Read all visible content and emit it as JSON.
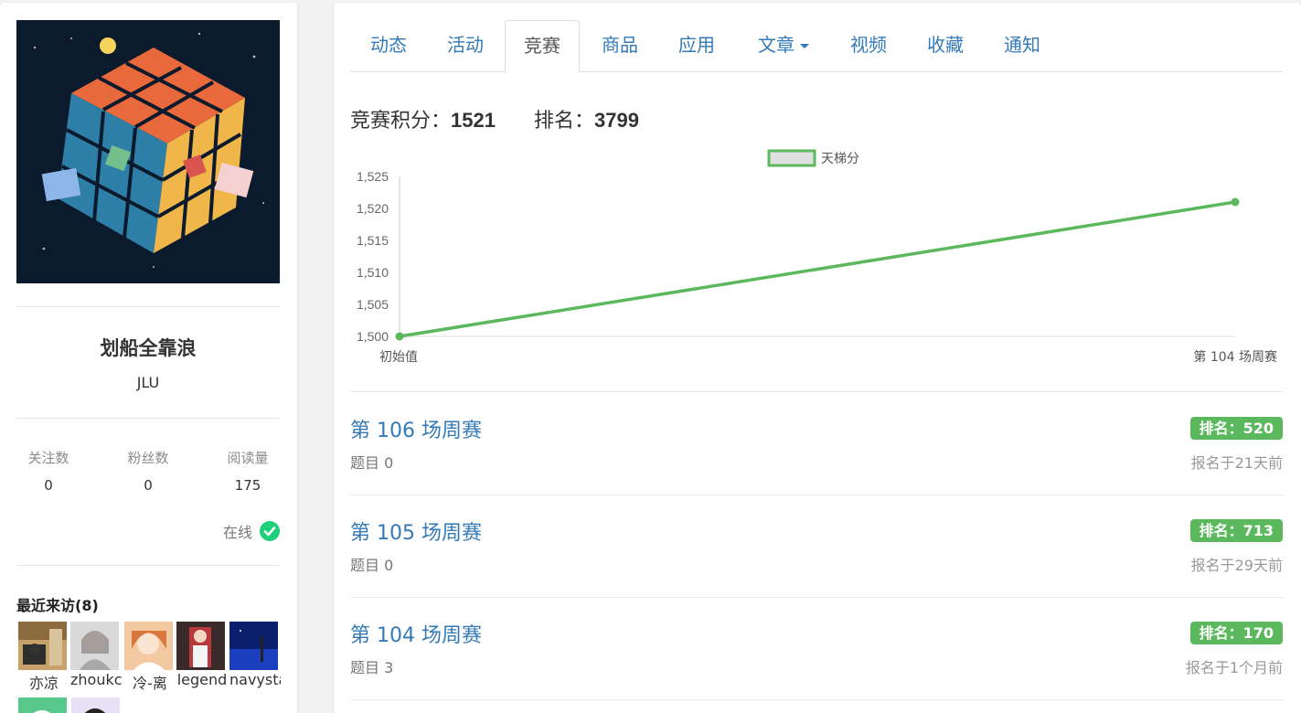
{
  "profile": {
    "username": "划船全靠浪",
    "school": "JLU",
    "stats": [
      {
        "label": "关注数",
        "value": "0"
      },
      {
        "label": "粉丝数",
        "value": "0"
      },
      {
        "label": "阅读量",
        "value": "175"
      }
    ],
    "status": "在线",
    "recent_visitors_title": "最近来访(8)",
    "visitors": [
      {
        "name": "亦凉"
      },
      {
        "name": "zhoukc"
      },
      {
        "name": "冷-离"
      },
      {
        "name": "legend"
      },
      {
        "name": "navystar"
      }
    ]
  },
  "tabs": [
    {
      "label": "动态"
    },
    {
      "label": "活动"
    },
    {
      "label": "竞赛",
      "active": true
    },
    {
      "label": "商品"
    },
    {
      "label": "应用"
    },
    {
      "label": "文章",
      "dropdown": true
    },
    {
      "label": "视频"
    },
    {
      "label": "收藏"
    },
    {
      "label": "通知"
    }
  ],
  "summary": {
    "score_label": "竞赛积分：",
    "score_value": "1521",
    "rank_label": "排名：",
    "rank_value": "3799"
  },
  "chart_data": {
    "type": "line",
    "categories": [
      "初始值",
      "第 104 场周赛"
    ],
    "series": [
      {
        "name": "天梯分",
        "values": [
          1500,
          1521
        ]
      }
    ],
    "ylim": [
      1500,
      1525
    ],
    "y_ticks": [
      "1,500",
      "1,505",
      "1,510",
      "1,515",
      "1,520",
      "1,525"
    ],
    "legend_position": "top-center",
    "color": "#5cb85c"
  },
  "contests": [
    {
      "title": "第 106 场周赛",
      "problems": "题目 0",
      "rank": "排名：520",
      "signup": "报名于21天前"
    },
    {
      "title": "第 105 场周赛",
      "problems": "题目 0",
      "rank": "排名：713",
      "signup": "报名于29天前"
    },
    {
      "title": "第 104 场周赛",
      "problems": "题目 3",
      "rank": "排名：170",
      "signup": "报名于1个月前"
    }
  ],
  "colors": {
    "link": "#337ab7",
    "badge": "#5cb85c",
    "online": "#1fd07a"
  }
}
